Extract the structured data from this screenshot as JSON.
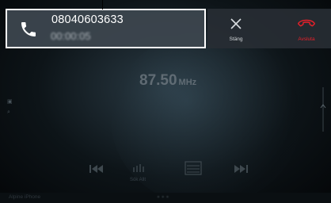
{
  "call": {
    "number": "08040603633",
    "duration": "00:00:05"
  },
  "actions": {
    "close_label": "Stäng",
    "end_label": "Avsluta"
  },
  "radio": {
    "frequency": "87.50",
    "unit": "MHz",
    "search_label": "Sök Allt"
  },
  "footer": {
    "device": "Alpine iPhone"
  },
  "colors": {
    "end_call": "#e8202a",
    "popup_bg": "#3c464e",
    "highlight_border": "#ffffff"
  }
}
